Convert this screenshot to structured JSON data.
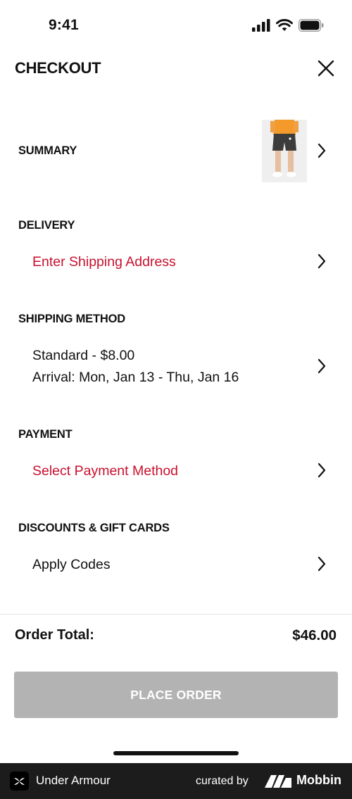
{
  "status_bar": {
    "time": "9:41"
  },
  "header": {
    "title": "CHECKOUT"
  },
  "sections": {
    "summary": {
      "label": "SUMMARY"
    },
    "delivery": {
      "label": "DELIVERY",
      "value": "Enter Shipping Address"
    },
    "shipping_method": {
      "label": "SHIPPING METHOD",
      "line1": "Standard - $8.00",
      "line2": "Arrival: Mon, Jan 13 - Thu, Jan 16"
    },
    "payment": {
      "label": "PAYMENT",
      "value": "Select Payment Method"
    },
    "discounts": {
      "label": "DISCOUNTS & GIFT CARDS",
      "value": "Apply Codes"
    }
  },
  "order_total": {
    "label": "Order Total:",
    "value": "$46.00"
  },
  "place_order": {
    "label": "PLACE ORDER"
  },
  "footer": {
    "brand": "Under Armour",
    "curated_by": "curated by",
    "curator": "Mobbin"
  },
  "colors": {
    "accent": "#c8102e",
    "button_disabled": "#b3b3b3",
    "footer_bg": "#1c1c1c"
  }
}
